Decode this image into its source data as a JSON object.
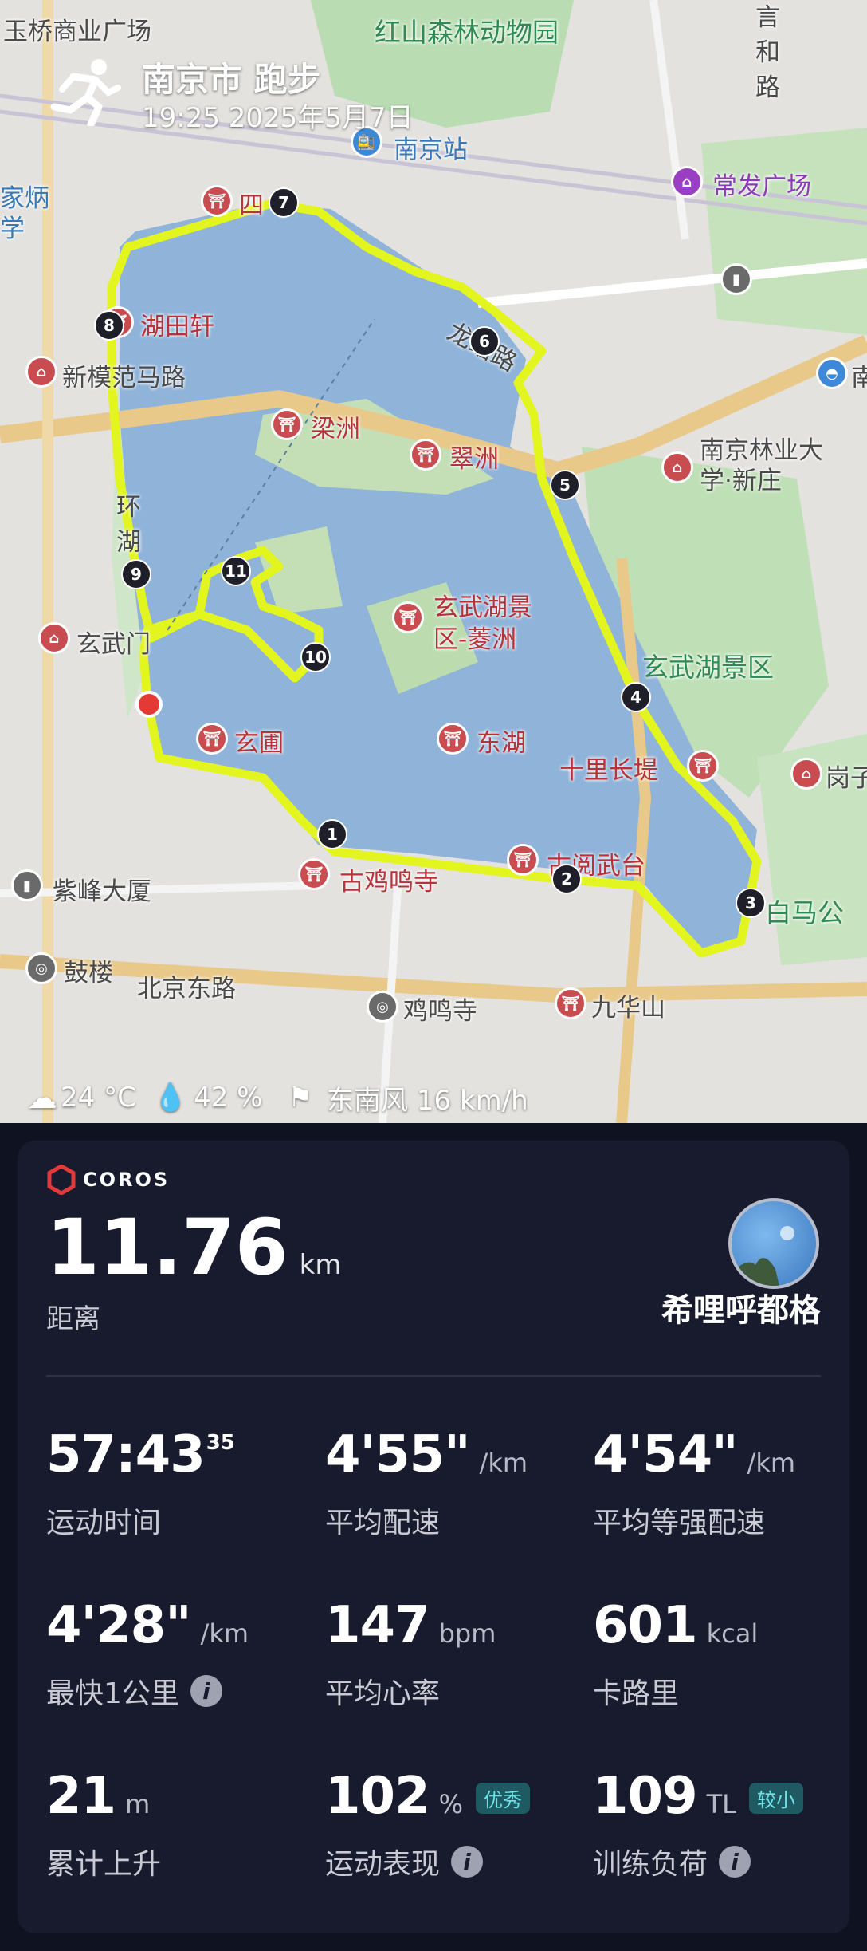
{
  "map": {
    "title": "南京市 跑步",
    "datetime": "19:25 2025年5月7日",
    "labels": {
      "yuqiao": "玉桥商业广场",
      "hongshan": "红山森林动物园",
      "yanhelu": "言\n和\n路",
      "nanjing_station": "南京站",
      "changfa": "常发广场",
      "jia": "家炳\n学",
      "sizhiting": "四 亭",
      "hutianxuan": "湖田轩",
      "xinmofan": "新模范马路",
      "longpanlu": "龙蟠路",
      "liangzhou": "梁洲",
      "cuizhou": "翠洲",
      "forestry_univ": "南京林业大\n学·新庄",
      "huan_hu": "环\n湖",
      "xuanwumen": "玄武门",
      "lingzhou": "玄武湖景\n区-菱洲",
      "xuanwu_scenic": "玄武湖景区",
      "xuanpu": "玄圃",
      "donghu": "东湖",
      "shilichangdi": "十里长堤",
      "gangzi": "岗子",
      "gujiming": "古鸡鸣寺",
      "guyuewutai": "古阅武台",
      "baimagong": "白马公",
      "zifeng": "紫峰大厦",
      "gulou": "鼓楼",
      "beijing_east": "北京东路",
      "jimingsi": "鸡鸣寺",
      "jiuhuashan": "九华山",
      "nan": "南"
    },
    "markers": [
      "1",
      "2",
      "3",
      "4",
      "5",
      "6",
      "7",
      "8",
      "9",
      "10",
      "11"
    ],
    "weather": {
      "temp": "24 °C",
      "humidity": "42 %",
      "wind": "东南风 16 km/h"
    },
    "route_color": "#e3f51f",
    "lake_color": "#8fb3d9"
  },
  "card": {
    "brand": "COROS",
    "distance": {
      "value": "11.76",
      "unit": "km",
      "label": "距离"
    },
    "username": "希哩呼都格",
    "stats": [
      {
        "value": "57:43",
        "sup": "35",
        "unit": "",
        "label": "运动时间"
      },
      {
        "value": "4'55\"",
        "unit": "/km",
        "label": "平均配速"
      },
      {
        "value": "4'54\"",
        "unit": "/km",
        "label": "平均等强配速"
      },
      {
        "value": "4'28\"",
        "unit": "/km",
        "label": "最快1公里",
        "info": true
      },
      {
        "value": "147",
        "unit": "bpm",
        "label": "平均心率"
      },
      {
        "value": "601",
        "unit": "kcal",
        "label": "卡路里"
      },
      {
        "value": "21",
        "unit": "m",
        "label": "累计上升"
      },
      {
        "value": "102",
        "unit": "%",
        "badge": "优秀",
        "label": "运动表现",
        "info": true
      },
      {
        "value": "109",
        "unit": "TL",
        "badge": "较小",
        "label": "训练负荷",
        "info": true
      }
    ]
  }
}
